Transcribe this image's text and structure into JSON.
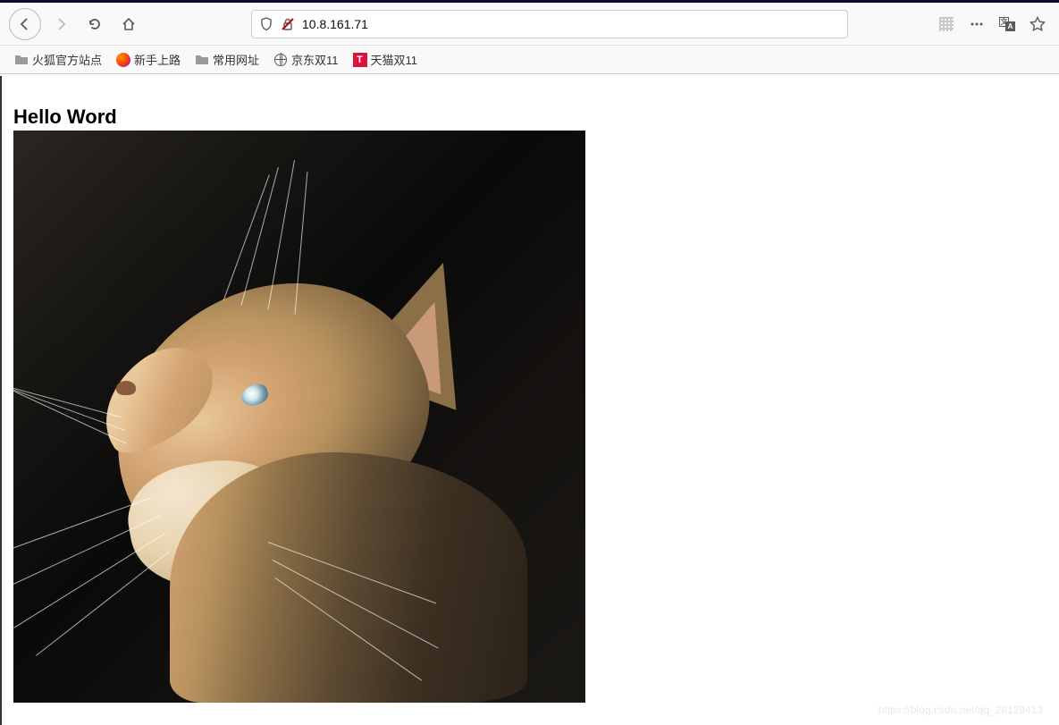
{
  "toolbar": {
    "url": "10.8.161.71"
  },
  "bookmarks": [
    {
      "label": "火狐官方站点",
      "icon": "folder"
    },
    {
      "label": "新手上路",
      "icon": "firefox"
    },
    {
      "label": "常用网址",
      "icon": "folder"
    },
    {
      "label": "京东双11",
      "icon": "globe"
    },
    {
      "label": "天猫双11",
      "icon": "tmall"
    }
  ],
  "page": {
    "heading": "Hello Word"
  },
  "watermark": "https://blog.csdn.net/qq_28129413"
}
